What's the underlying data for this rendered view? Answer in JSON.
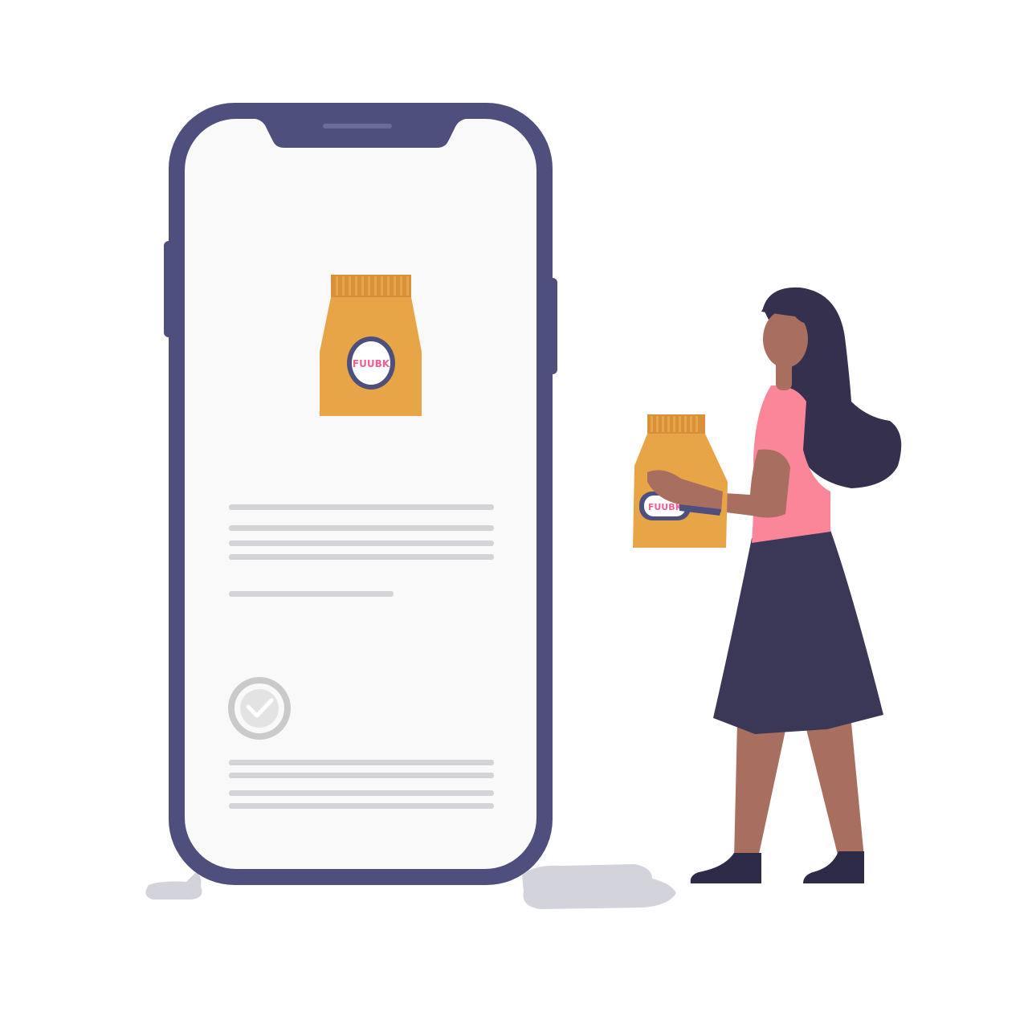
{
  "colors": {
    "phone_frame": "#4e4f7c",
    "screen": "#f9f9f9",
    "bag": "#e8a547",
    "bag_top": "#d8913a",
    "logo_accent": "#f05f8f",
    "skeleton_line": "#d4d4d8",
    "check_circle": "#cacaca",
    "shadow": "#d3d3dc",
    "skin": "#a86f60",
    "hair": "#35304e",
    "shirt": "#fb8599",
    "skirt": "#3b3857",
    "shoes": "#2d2b47"
  },
  "screen": {
    "product_logo_text": "FUUBK",
    "check_icon": "check-circle-icon"
  },
  "person": {
    "held_bag_logo_text": "FUUBK"
  }
}
